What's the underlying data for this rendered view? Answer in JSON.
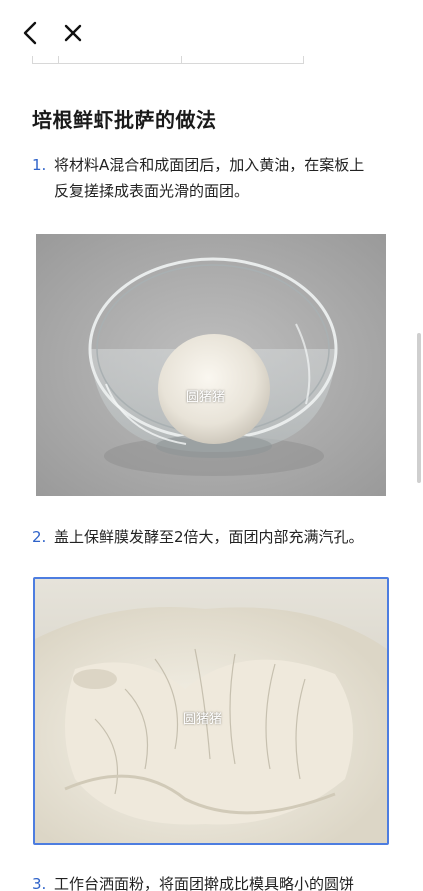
{
  "nav": {
    "back_icon": "chevron-left-icon",
    "close_icon": "close-icon"
  },
  "title": "培根鲜虾批萨的做法",
  "steps": [
    {
      "num": "1.",
      "line1": "将材料A混合和成面团后，加入黄油，在案板上",
      "line2": "反复搓揉成表面光滑的面团。"
    },
    {
      "num": "2.",
      "line1": "盖上保鲜膜发酵至2倍大，面团内部充满汽孔。"
    },
    {
      "num": "3.",
      "line1": "工作台洒面粉，将面团擀成比模具略小的圆饼"
    }
  ],
  "images": {
    "img1_watermark": "圆猪猪",
    "img2_watermark": "圆猪猪"
  },
  "colors": {
    "accent": "#2f63c9",
    "highlight_border": "#4d7de0"
  }
}
